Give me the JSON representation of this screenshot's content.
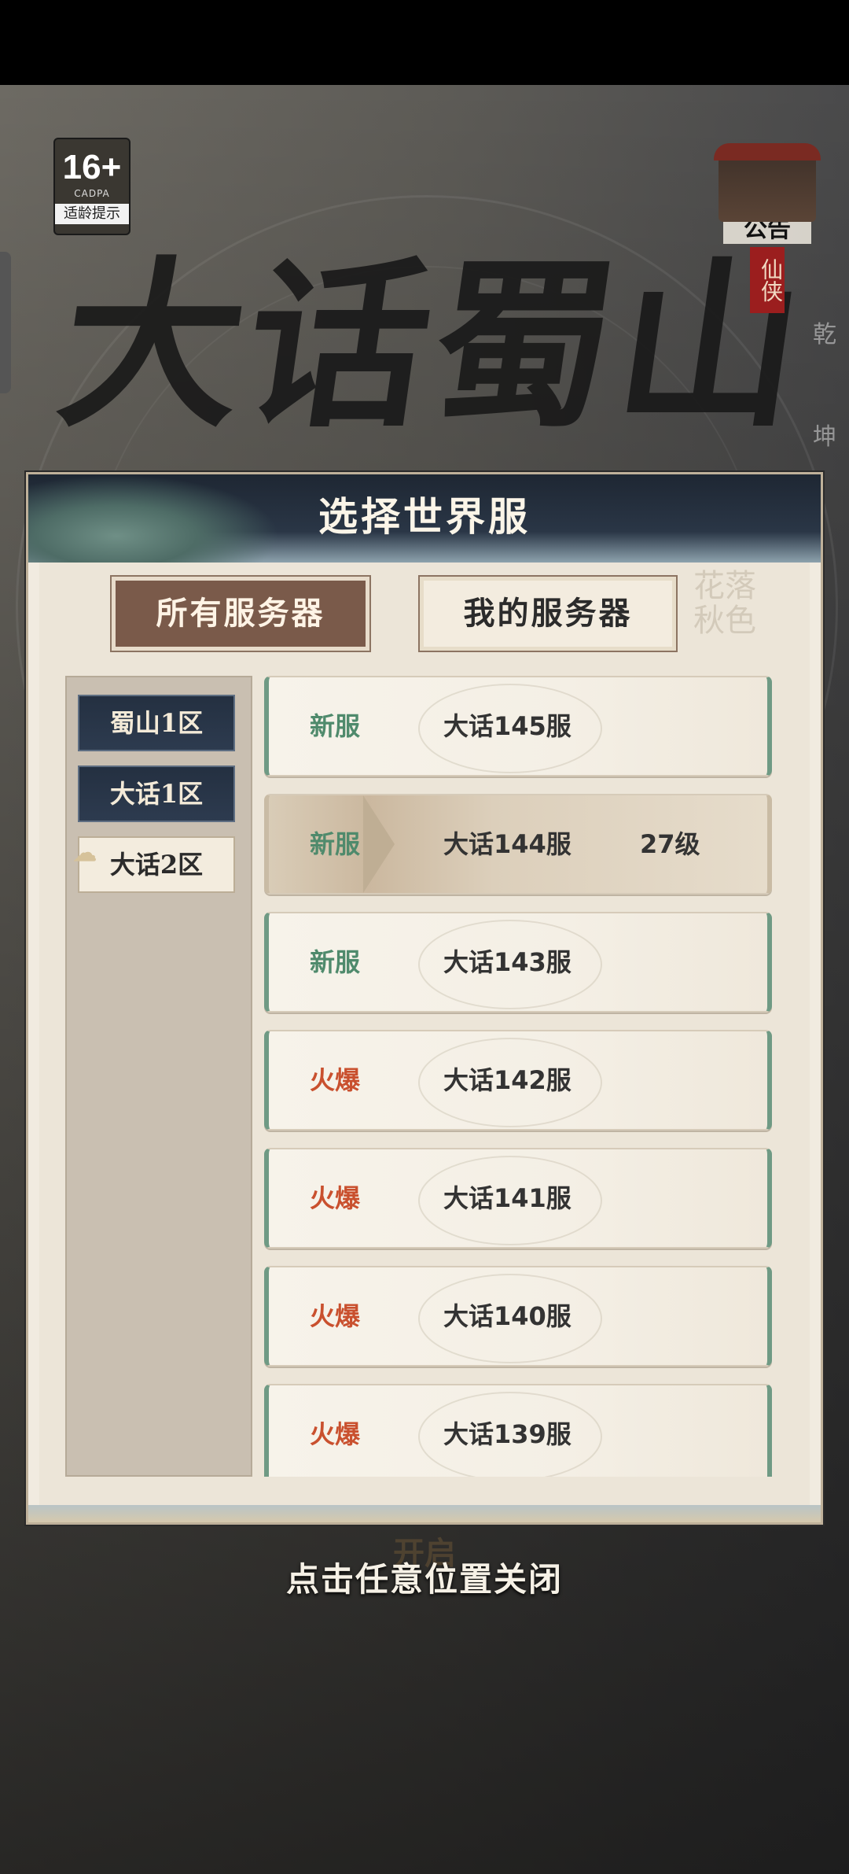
{
  "age_badge": {
    "rating": "16+",
    "org": "CADPA",
    "tip": "适龄提示"
  },
  "notice": {
    "label": "公告",
    "tag": "仙侠"
  },
  "side_glyphs": [
    "乾",
    "坤"
  ],
  "game_title": "大话蜀山",
  "modal": {
    "title": "选择世界服",
    "tabs": {
      "all": "所有服务器",
      "mine": "我的服务器"
    },
    "zones": [
      "蜀山1区",
      "大话1区",
      "大话2区"
    ],
    "selected_zone": "大话2区",
    "servers": [
      {
        "status": "新服",
        "name": "大话145服",
        "level": ""
      },
      {
        "status": "新服",
        "name": "大话144服",
        "level": "27级"
      },
      {
        "status": "新服",
        "name": "大话143服",
        "level": ""
      },
      {
        "status": "火爆",
        "name": "大话142服",
        "level": ""
      },
      {
        "status": "火爆",
        "name": "大话141服",
        "level": ""
      },
      {
        "status": "火爆",
        "name": "大话140服",
        "level": ""
      },
      {
        "status": "火爆",
        "name": "大话139服",
        "level": ""
      }
    ],
    "selected_server": "大话144服"
  },
  "behind_button": "开启",
  "close_hint": "点击任意位置关闭",
  "colors": {
    "new_status": "#4f8a6c",
    "hot_status": "#c9502e",
    "header": "#1e2733"
  }
}
